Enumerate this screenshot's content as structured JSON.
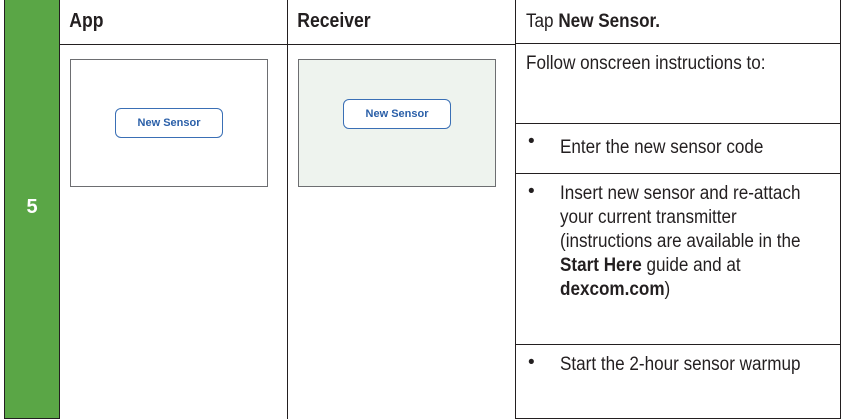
{
  "step": {
    "number": "5"
  },
  "columns": {
    "app_header": "App",
    "receiver_header": "Receiver"
  },
  "app_screen": {
    "button_label": "New Sensor"
  },
  "receiver_screen": {
    "button_label": "New Sensor"
  },
  "instructions": {
    "tap_prefix": "Tap ",
    "tap_target": "New Sensor.",
    "follow_text": "Follow onscreen instructions to:",
    "bullets": [
      {
        "text": "Enter the new sensor code"
      },
      {
        "text_a": "Insert new sensor and re-attach your current transmitter (instructions are available in the ",
        "bold_a": "Start Here",
        "text_b": " guide and at ",
        "bold_b": "dexcom.com",
        "text_c": ")"
      },
      {
        "text": "Start the 2-hour sensor warmup"
      }
    ],
    "bullet_glyph": "•"
  },
  "colors": {
    "step_green": "#5aa646",
    "button_blue": "#2a5fa8",
    "receiver_bg": "#eef3ee"
  }
}
